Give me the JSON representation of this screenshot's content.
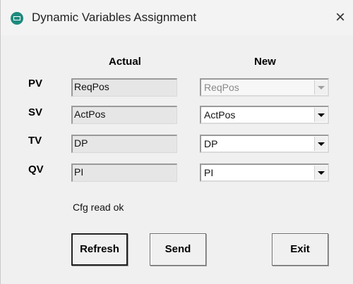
{
  "window": {
    "title": "Dynamic Variables Assignment",
    "close_glyph": "×"
  },
  "headers": {
    "actual": "Actual",
    "new": "New"
  },
  "rows": [
    {
      "label": "PV",
      "actual": "ReqPos",
      "new": "ReqPos",
      "new_enabled": false
    },
    {
      "label": "SV",
      "actual": "ActPos",
      "new": "ActPos",
      "new_enabled": true
    },
    {
      "label": "TV",
      "actual": "DP",
      "new": "DP",
      "new_enabled": true
    },
    {
      "label": "QV",
      "actual": "PI",
      "new": "PI",
      "new_enabled": true
    }
  ],
  "status": "Cfg read ok",
  "buttons": {
    "refresh": "Refresh",
    "send": "Send",
    "exit": "Exit"
  },
  "icons": {
    "app": "app-icon",
    "close": "close-icon",
    "dropdown": "dropdown-arrow-icon"
  },
  "colors": {
    "app_icon": "#1e8a7e",
    "window_bg": "#f0f0f0"
  }
}
